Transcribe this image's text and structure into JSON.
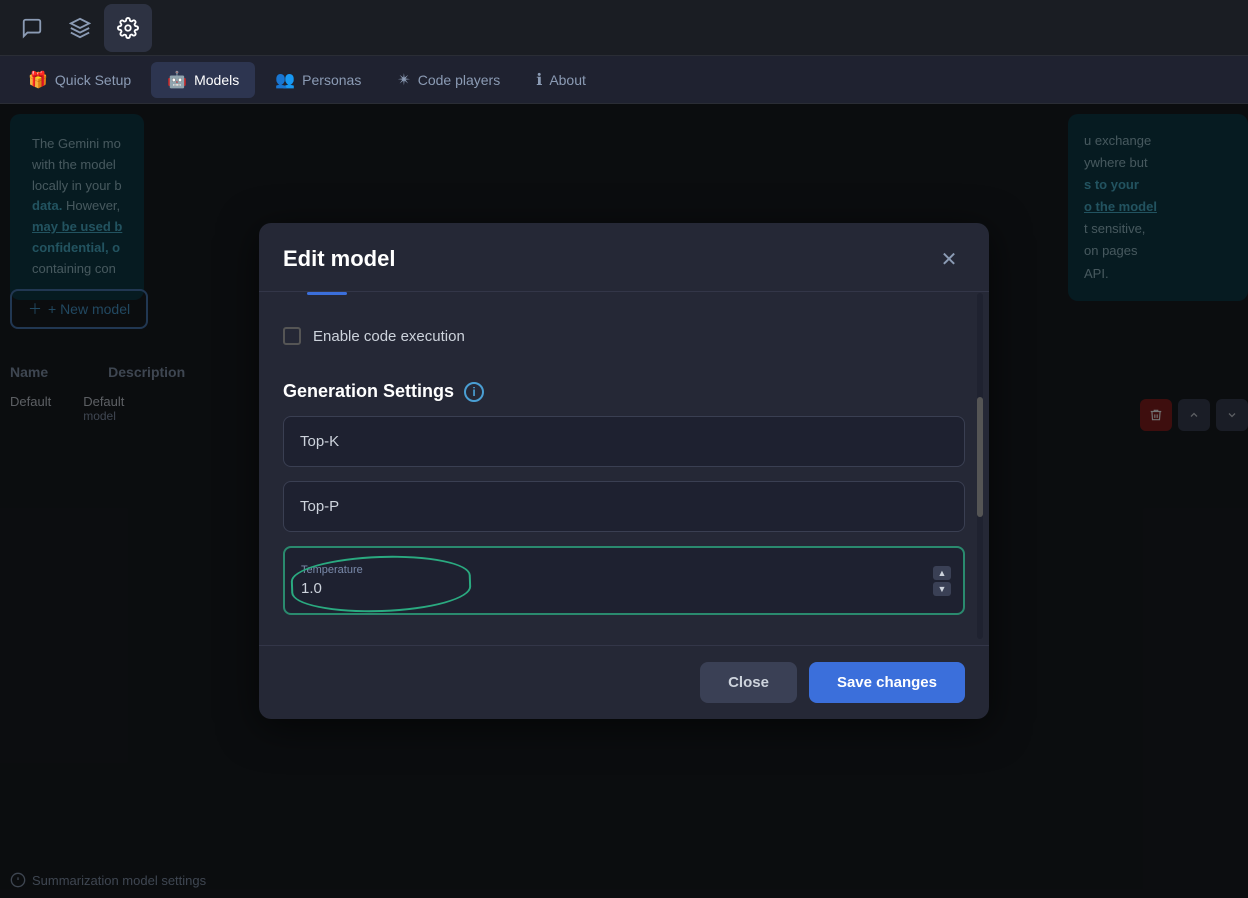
{
  "topBar": {
    "icons": [
      {
        "name": "chat-icon",
        "symbol": "💬",
        "active": false
      },
      {
        "name": "layers-icon",
        "symbol": "⬛",
        "active": false
      },
      {
        "name": "settings-icon",
        "symbol": "⚙",
        "active": true
      }
    ]
  },
  "navTabs": {
    "tabs": [
      {
        "id": "quick-setup",
        "label": "Quick Setup",
        "icon": "🎁",
        "active": false
      },
      {
        "id": "models",
        "label": "Models",
        "icon": "🤖",
        "active": true
      },
      {
        "id": "personas",
        "label": "Personas",
        "icon": "👥",
        "active": false
      },
      {
        "id": "code-players",
        "label": "Code players",
        "icon": "✴",
        "active": false
      },
      {
        "id": "about",
        "label": "About",
        "icon": "ℹ",
        "active": false
      }
    ]
  },
  "background": {
    "infoCard": {
      "text1": "The Gemini mo",
      "text2": "with the model",
      "text3": "locally in your b",
      "boldText": "data.",
      "text4": "However,",
      "linkText": "may be used b",
      "boldText2": "confidential, o",
      "text5": "containing con"
    },
    "rightCard": {
      "text1": "u exchange",
      "text2": "ywhere but",
      "boldText": "s to your",
      "linkText": "o the model",
      "text3": "t sensitive,",
      "text4": "on pages",
      "text5": "API."
    },
    "newModelBtn": "+ New model",
    "tableHeaders": [
      "Name",
      "Description"
    ],
    "tableRow": {
      "name": "Default",
      "desc1": "Default",
      "desc2": "model"
    },
    "bottomText": "Summarization model settings"
  },
  "modal": {
    "title": "Edit model",
    "closeLabel": "×",
    "checkbox": {
      "label": "Enable code execution",
      "checked": false
    },
    "sectionTitle": "Generation Settings",
    "fields": {
      "topK": {
        "label": "",
        "placeholder": "Top-K",
        "value": ""
      },
      "topP": {
        "label": "",
        "placeholder": "Top-P",
        "value": ""
      },
      "temperature": {
        "label": "Temperature",
        "value": "1.0"
      }
    },
    "footer": {
      "closeLabel": "Close",
      "saveLabel": "Save changes"
    }
  }
}
